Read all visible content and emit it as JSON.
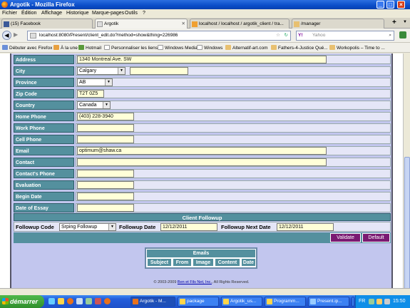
{
  "window": {
    "title": "Argotik - Mozilla Firefox"
  },
  "menu": [
    "Fichier",
    "Édition",
    "Affichage",
    "Historique",
    "Marque-pages",
    "Outils",
    "?"
  ],
  "tabs": [
    {
      "label": "(15) Facebook"
    },
    {
      "label": "Argotik"
    },
    {
      "label": "localhost / localhost / argotik_client / tra..."
    },
    {
      "label": "/manager"
    }
  ],
  "nav": {
    "url": "localhost:8080/Present/client_edit.do?method=show&thing=226986",
    "search_placeholder": "Yahoo"
  },
  "bookmarks": [
    "Débuter avec Firefox",
    "À la une",
    "Hotmail",
    "Personnaliser les liens",
    "Windows Media",
    "Windows",
    "Alternatif-art.com",
    "Fathers-4-Justice Qué...",
    "Workopolis – Time to ..."
  ],
  "form": {
    "rows": [
      {
        "label": "Address",
        "value": "1340 Montreal Ave. SW"
      },
      {
        "label": "City",
        "value": "Calgary"
      },
      {
        "label": "Province",
        "value": "AB"
      },
      {
        "label": "Zip Code",
        "value": "T2T 0Z5"
      },
      {
        "label": "Country",
        "value": "Canada"
      },
      {
        "label": "Home Phone",
        "value": "(403) 228-3940"
      },
      {
        "label": "Work Phone",
        "value": ""
      },
      {
        "label": "Cell Phone",
        "value": ""
      },
      {
        "label": "Email",
        "value": "optimum@shaw.ca"
      },
      {
        "label": "Contact",
        "value": ""
      },
      {
        "label": "Contact's Phone",
        "value": ""
      },
      {
        "label": "Evaluation",
        "value": ""
      },
      {
        "label": "Begin Date",
        "value": ""
      },
      {
        "label": "Date of Essay",
        "value": ""
      }
    ],
    "followup": {
      "header": "Client Followup",
      "code_label": "Followup Code",
      "code_value": "Srping Followup",
      "date_label": "Followup Date",
      "date_value": "12/12/2011",
      "next_label": "Followup Next Date",
      "next_value": "12/12/2011"
    },
    "buttons": {
      "validate": "Validate",
      "default": "Default"
    }
  },
  "emails": {
    "header": "Emails",
    "columns": [
      "Subject",
      "From",
      "Image",
      "Content",
      "Date"
    ]
  },
  "footer": {
    "copyright": "© 2003-2009",
    "company": "Ben et Fils Net, Inc.",
    "rights": ", All Rights Reserved."
  },
  "taskbar": {
    "start": "démarrer",
    "items": [
      "Argotik - M...",
      "package",
      "Argotik_us...",
      "Programm...",
      "Present.ip...",
      ""
    ],
    "lang": "FR",
    "clock": "15:50"
  }
}
